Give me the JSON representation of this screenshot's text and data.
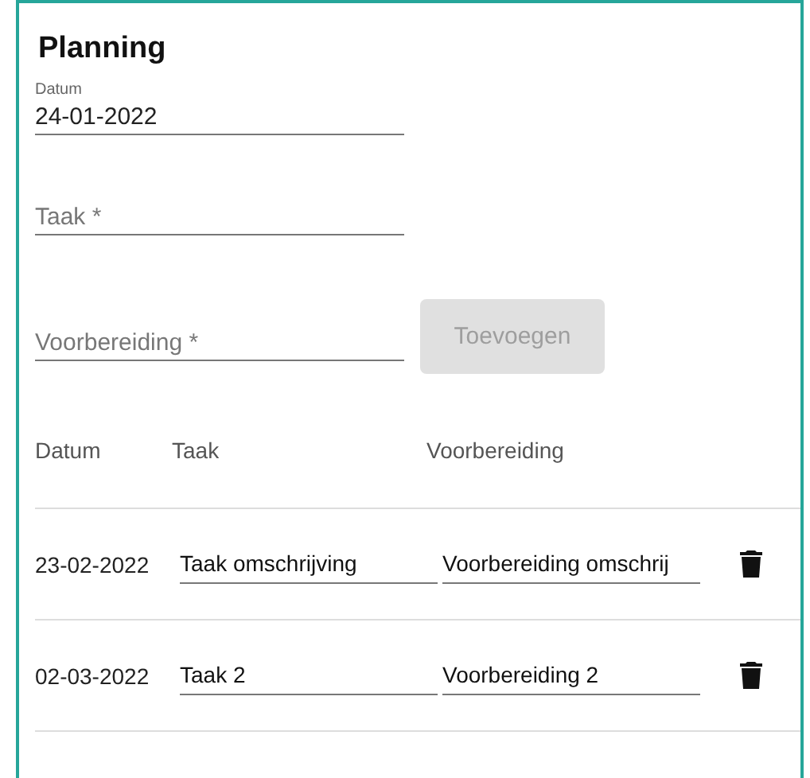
{
  "title": "Planning",
  "form": {
    "date": {
      "label": "Datum",
      "value": "24-01-2022"
    },
    "task": {
      "placeholder": "Taak *"
    },
    "preparation": {
      "placeholder": "Voorbereiding *"
    },
    "add_button": {
      "label": "Toevoegen",
      "disabled": true
    }
  },
  "table": {
    "columns": [
      "Datum",
      "Taak",
      "Voorbereiding"
    ],
    "rows": [
      {
        "date": "23-02-2022",
        "task": "Taak omschrijving",
        "preparation": "Voorbereiding omschrij"
      },
      {
        "date": "02-03-2022",
        "task": "Taak 2",
        "preparation": "Voorbereiding 2"
      }
    ]
  }
}
